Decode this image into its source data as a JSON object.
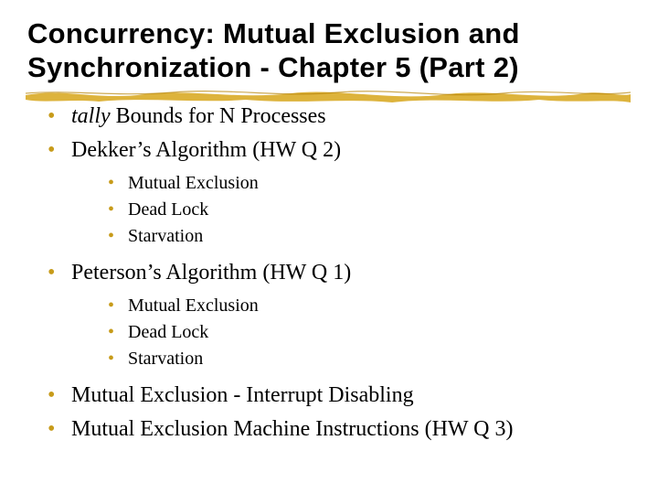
{
  "title": "Concurrency: Mutual Exclusion and Synchronization - Chapter 5 (Part 2)",
  "bullets": {
    "b1_prefix": "tally",
    "b1_rest": " Bounds for N Processes",
    "b2": "Dekker’s Algorithm (HW Q 2)",
    "b2_sub": {
      "s1": "Mutual Exclusion",
      "s2": "Dead Lock",
      "s3": "Starvation"
    },
    "b3": "Peterson’s Algorithm (HW Q 1)",
    "b3_sub": {
      "s1": "Mutual Exclusion",
      "s2": "Dead Lock",
      "s3": "Starvation"
    },
    "b4": "Mutual Exclusion - Interrupt Disabling",
    "b5": "Mutual Exclusion Machine Instructions (HW Q 3)"
  }
}
